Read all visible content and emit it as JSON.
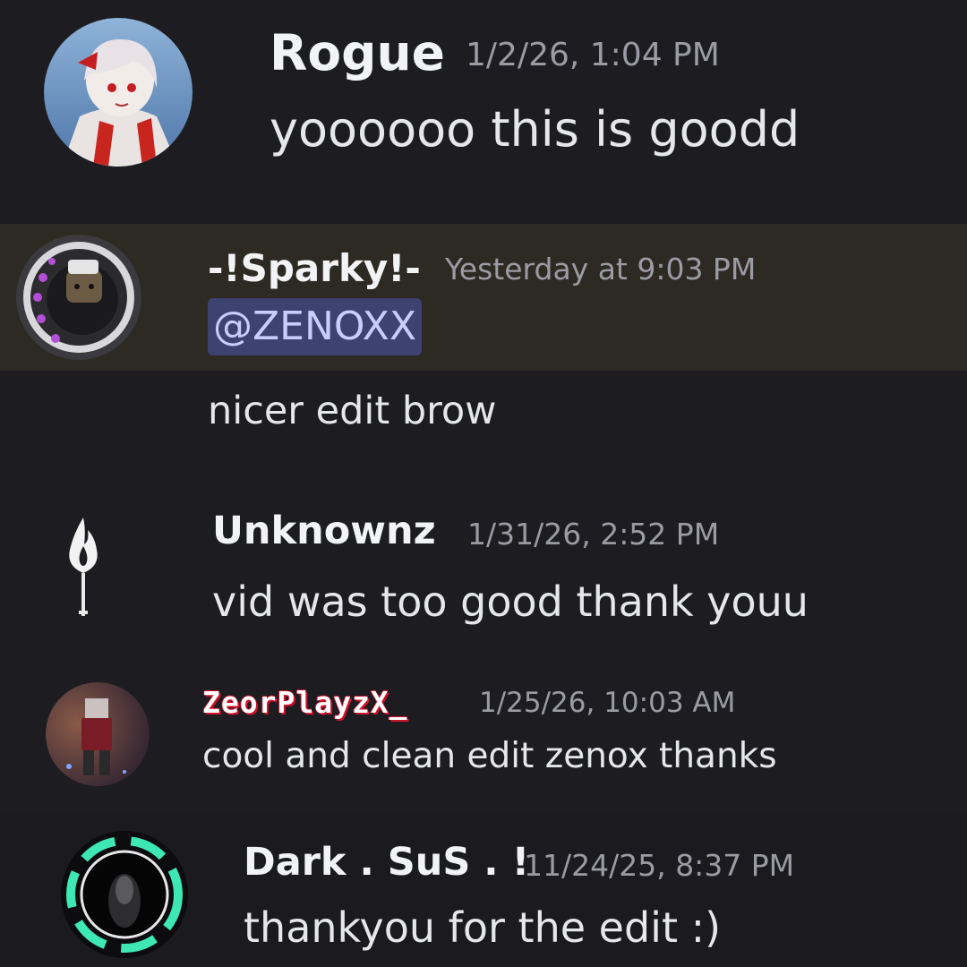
{
  "messages": [
    {
      "username": "Rogue",
      "timestamp": "1/2/26, 1:04 PM",
      "text": "yoooooo this is goodd",
      "avatar_icon": "anime-character-avatar"
    },
    {
      "username": "-!Sparky!-",
      "timestamp": "Yesterday at 9:03 PM",
      "mention": "@ZENOXX",
      "text": "nicer edit brow",
      "avatar_icon": "hooded-character-avatar"
    },
    {
      "username": "Unknownz",
      "timestamp": "1/31/26, 2:52 PM",
      "text": "vid was too good thank youu",
      "avatar_icon": "flame-key-avatar"
    },
    {
      "username": "ZeorPlayzX_",
      "timestamp": "1/25/26, 10:03 AM",
      "text": "cool and clean edit zenox thanks",
      "avatar_icon": "roblox-character-avatar"
    },
    {
      "username": "Dark . SuS . !",
      "timestamp": "11/24/25, 8:37 PM",
      "text": "thankyou for the edit :)",
      "avatar_icon": "dark-portal-avatar"
    }
  ],
  "colors": {
    "background": "#1c1c21",
    "mention_highlight": "#2c2a22",
    "mention_pill_bg": "#3d4270",
    "mention_pill_text": "#c9cdfb",
    "username": "#f2f3f5",
    "timestamp": "#9b9ca3",
    "message_text": "#e6e7ea",
    "pixel_name_shadow": "#d1102a",
    "ring_accent": "#3de8b5"
  }
}
